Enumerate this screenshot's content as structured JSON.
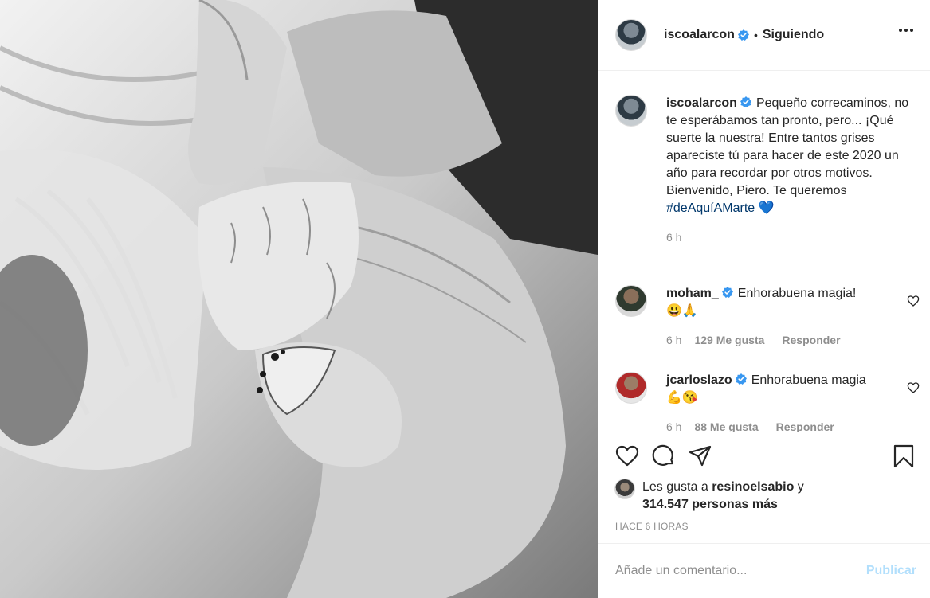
{
  "post": {
    "author": "iscoalarcon",
    "separator": "•",
    "follow_status": "Siguiendo",
    "caption": {
      "username": "iscoalarcon",
      "text": "Pequeño correcaminos, no te esperábamos tan pronto, pero... ¡Qué suerte la nuestra! Entre tantos grises apareciste tú para hacer de este 2020 un año para recordar por otros motivos.",
      "text2": "Bienvenido, Piero. Te queremos",
      "hashtag": "#deAquíAMarte",
      "emoji": "💙",
      "time": "6 h"
    },
    "comments": [
      {
        "username": "moham_",
        "text": "Enhorabuena magia!",
        "emoji": "😃🙏",
        "time": "6 h",
        "likes": "129 Me gusta",
        "reply": "Responder"
      },
      {
        "username": "jcarloslazo",
        "text": "Enhorabuena magia",
        "emoji": "💪😘",
        "time": "6 h",
        "likes": "88 Me gusta",
        "reply": "Responder"
      }
    ],
    "likes": {
      "prefix": "Les gusta a",
      "user": "resinoelsabio",
      "joiner": "y",
      "others": "314.547 personas más"
    },
    "timestamp": "HACE 6 HORAS",
    "composer": {
      "placeholder": "Añade un comentario...",
      "publish": "Publicar"
    }
  },
  "icons": [
    "heart-icon",
    "comment-icon",
    "share-icon",
    "bookmark-icon",
    "more-options-icon",
    "verified-badge-icon"
  ],
  "colors": {
    "verified": "#3897f0",
    "hashtag": "#00376b",
    "publish_disabled": "#b2dffc",
    "muted": "#8e8e8e"
  }
}
